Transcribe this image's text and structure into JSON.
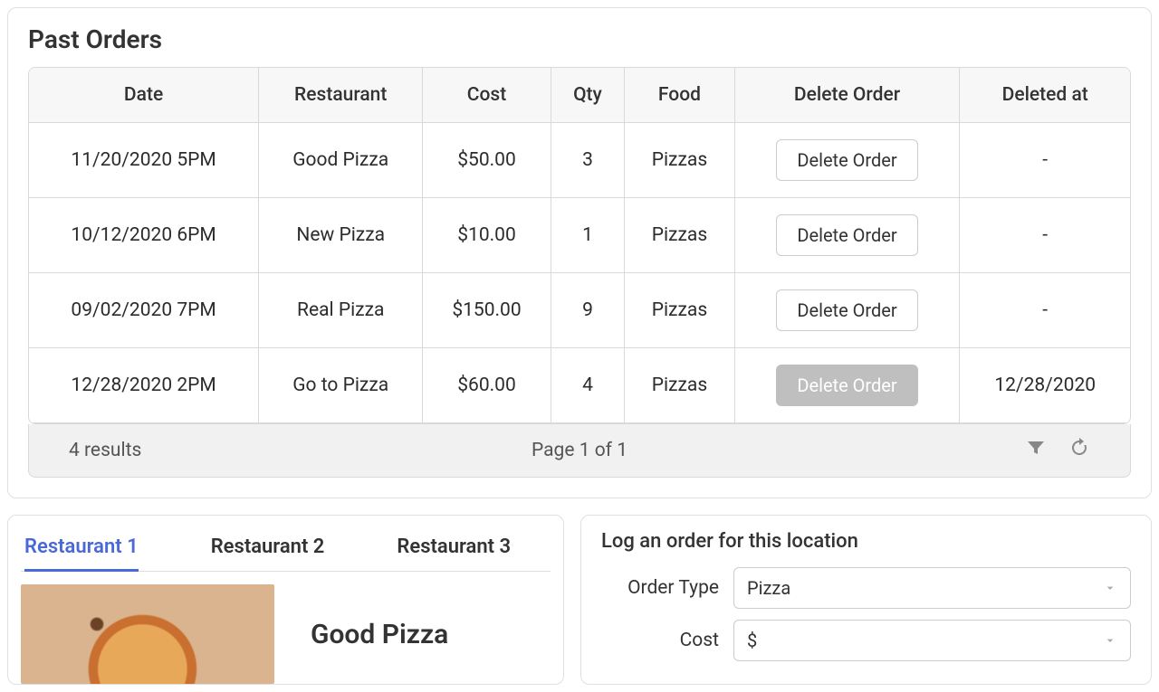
{
  "pastOrders": {
    "title": "Past Orders",
    "headers": {
      "date": "Date",
      "restaurant": "Restaurant",
      "cost": "Cost",
      "qty": "Qty",
      "food": "Food",
      "deleteOrder": "Delete Order",
      "deletedAt": "Deleted at"
    },
    "rows": [
      {
        "date": "11/20/2020 5PM",
        "restaurant": "Good Pizza",
        "cost": "$50.00",
        "qty": "3",
        "food": "Pizzas",
        "deleteLabel": "Delete Order",
        "deleteDisabled": false,
        "deletedAt": "-"
      },
      {
        "date": "10/12/2020 6PM",
        "restaurant": "New Pizza",
        "cost": "$10.00",
        "qty": "1",
        "food": "Pizzas",
        "deleteLabel": "Delete Order",
        "deleteDisabled": false,
        "deletedAt": "-"
      },
      {
        "date": "09/02/2020 7PM",
        "restaurant": "Real Pizza",
        "cost": "$150.00",
        "qty": "9",
        "food": "Pizzas",
        "deleteLabel": "Delete Order",
        "deleteDisabled": false,
        "deletedAt": "-"
      },
      {
        "date": "12/28/2020 2PM",
        "restaurant": "Go to Pizza",
        "cost": "$60.00",
        "qty": "4",
        "food": "Pizzas",
        "deleteLabel": "Delete Order",
        "deleteDisabled": true,
        "deletedAt": "12/28/2020"
      }
    ],
    "footer": {
      "results": "4 results",
      "page": "Page 1 of 1"
    }
  },
  "restaurants": {
    "tabs": [
      "Restaurant 1",
      "Restaurant 2",
      "Restaurant 3"
    ],
    "activeTab": 0,
    "selectedName": "Good Pizza"
  },
  "logOrder": {
    "title": "Log an order for this location",
    "fields": {
      "orderType": {
        "label": "Order Type",
        "value": "Pizza"
      },
      "cost": {
        "label": "Cost",
        "value": "$"
      }
    }
  }
}
